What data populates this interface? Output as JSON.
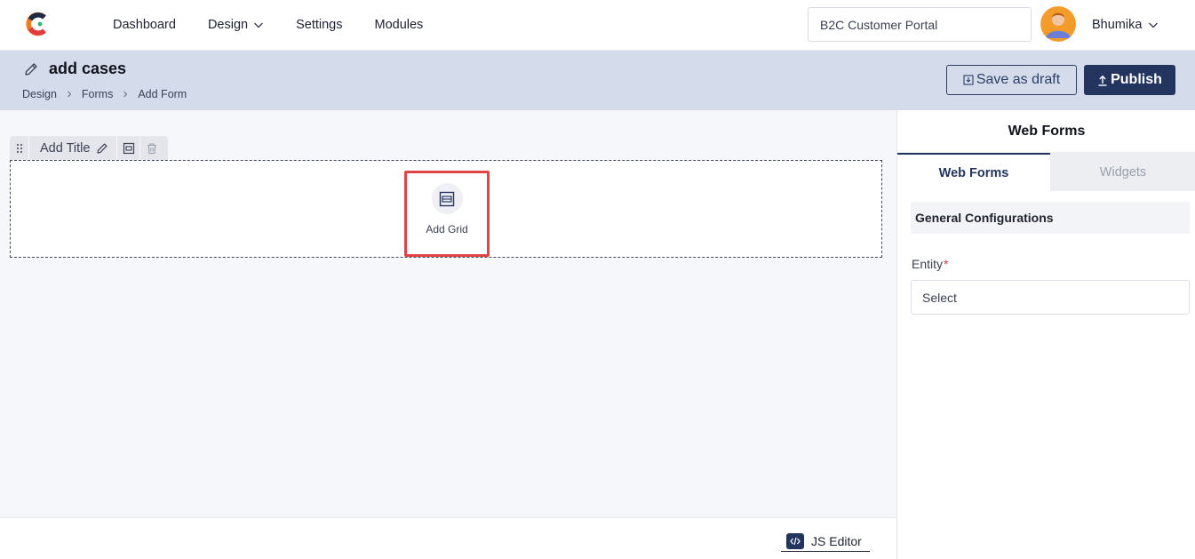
{
  "nav": {
    "items": [
      {
        "label": "Dashboard",
        "dropdown": false
      },
      {
        "label": "Design",
        "dropdown": true
      },
      {
        "label": "Settings",
        "dropdown": false
      },
      {
        "label": "Modules",
        "dropdown": false
      }
    ],
    "portal_select": "B2C Customer Portal",
    "user_name": "Bhumika"
  },
  "header": {
    "title": "add cases",
    "breadcrumb": [
      "Design",
      "Forms",
      "Add Form"
    ],
    "save_draft_label": "Save as draft",
    "publish_label": "Publish"
  },
  "canvas": {
    "add_title_label": "Add Title",
    "add_grid_label": "Add Grid"
  },
  "footer": {
    "js_editor_label": "JS Editor"
  },
  "panel": {
    "title": "Web Forms",
    "tabs": [
      {
        "label": "Web Forms",
        "active": true
      },
      {
        "label": "Widgets",
        "active": false
      }
    ],
    "section_title": "General Configurations",
    "entity_label": "Entity",
    "entity_required_mark": "*",
    "entity_select_value": "Select"
  },
  "colors": {
    "primary": "#23355e",
    "header_band": "#d4dcec",
    "canvas_bg": "#f6f7fa",
    "highlight": "#e04545",
    "required": "#d33a3a"
  }
}
